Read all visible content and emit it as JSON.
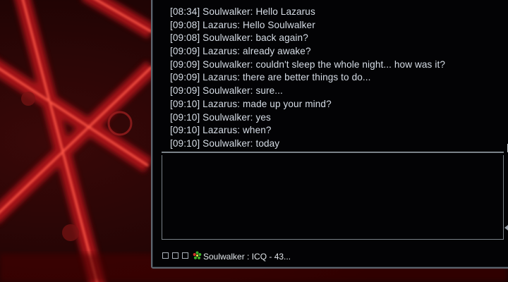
{
  "chat": {
    "messages": [
      {
        "time": "[08:34]",
        "sender": "Soulwalker",
        "text": "Hello Lazarus"
      },
      {
        "time": "[09:08]",
        "sender": "Lazarus",
        "text": "Hello Soulwalker"
      },
      {
        "time": "[09:08]",
        "sender": "Soulwalker",
        "text": "back again?"
      },
      {
        "time": "[09:09]",
        "sender": "Lazarus",
        "text": "already awake?"
      },
      {
        "time": "[09:09]",
        "sender": "Soulwalker",
        "text": "couldn't sleep the whole night... how was it?"
      },
      {
        "time": "[09:09]",
        "sender": "Lazarus",
        "text": "there are better things to do..."
      },
      {
        "time": "[09:09]",
        "sender": "Soulwalker",
        "text": "sure..."
      },
      {
        "time": "[09:10]",
        "sender": "Lazarus",
        "text": "made up your mind?"
      },
      {
        "time": "[09:10]",
        "sender": "Soulwalker",
        "text": "yes"
      },
      {
        "time": "[09:10]",
        "sender": "Lazarus",
        "text": "when?"
      },
      {
        "time": "[09:10]",
        "sender": "Soulwalker",
        "text": "today"
      }
    ]
  },
  "taskbar": {
    "window_label": "Soulwalker : ICQ - 43..."
  },
  "icons": {
    "taskbar": [
      "close-icon",
      "resize-icon",
      "window-icon",
      "icq-flower-icon"
    ]
  },
  "colors": {
    "chat_background": "#030305",
    "chat_text": "#d6dde6",
    "window_border": "#5e6770",
    "icq_green": "#3fae2a",
    "wallpaper_red": "#d21a1a"
  }
}
